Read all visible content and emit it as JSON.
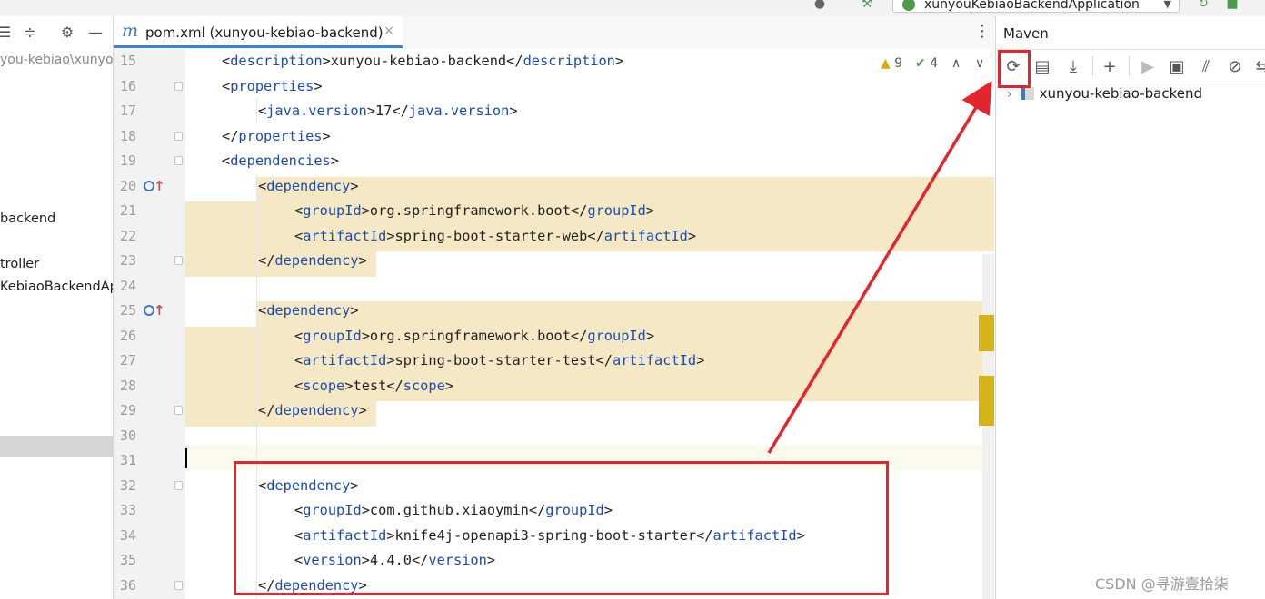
{
  "top_toolbar": {
    "run_config": "xunyouKebiaoBackendApplication"
  },
  "project_pane": {
    "path_fragment": "you-kebiao\\xunyo",
    "items": [
      "backend",
      "troller",
      "KebiaoBackendAp"
    ]
  },
  "editor": {
    "tab": {
      "icon_letter": "m",
      "title": "pom.xml (xunyou-kebiao-backend)",
      "close": "×"
    },
    "inspections": {
      "warnings": "9",
      "weak_warnings": "4"
    },
    "lines": [
      {
        "n": "15",
        "seg": [
          [
            "  "
          ],
          [
            "<",
            "p"
          ],
          [
            "description",
            "t"
          ],
          [
            ">xunyou-kebiao-backend</",
            "p"
          ],
          [
            "description",
            "t"
          ],
          [
            ">",
            "p"
          ]
        ]
      },
      {
        "n": "16",
        "seg": [
          [
            "<",
            "p"
          ],
          [
            "properties",
            "t"
          ],
          [
            ">",
            "p"
          ]
        ]
      },
      {
        "n": "17",
        "seg": [
          [
            "<",
            "p"
          ],
          [
            "java.version",
            "t"
          ],
          [
            ">17</",
            "p"
          ],
          [
            "java.version",
            "t"
          ],
          [
            ">",
            "p"
          ]
        ]
      },
      {
        "n": "18",
        "seg": [
          [
            "</",
            "p"
          ],
          [
            "properties",
            "t"
          ],
          [
            ">",
            "p"
          ]
        ]
      },
      {
        "n": "19",
        "seg": [
          [
            "<",
            "p"
          ],
          [
            "dependencies",
            "t"
          ],
          [
            ">",
            "p"
          ]
        ]
      },
      {
        "n": "20",
        "seg": [
          [
            "<",
            "p"
          ],
          [
            "dependency",
            "t"
          ],
          [
            ">",
            "p"
          ]
        ]
      },
      {
        "n": "21",
        "seg": [
          [
            "<",
            "p"
          ],
          [
            "groupId",
            "t"
          ],
          [
            ">org.springframework.boot</",
            "p"
          ],
          [
            "groupId",
            "t"
          ],
          [
            ">",
            "p"
          ]
        ]
      },
      {
        "n": "22",
        "seg": [
          [
            "<",
            "p"
          ],
          [
            "artifactId",
            "t"
          ],
          [
            ">spring-boot-starter-web</",
            "p"
          ],
          [
            "artifactId",
            "t"
          ],
          [
            ">",
            "p"
          ]
        ]
      },
      {
        "n": "23",
        "seg": [
          [
            "</",
            "p"
          ],
          [
            "dependency",
            "t"
          ],
          [
            ">",
            "p"
          ]
        ]
      },
      {
        "n": "24",
        "seg": []
      },
      {
        "n": "25",
        "seg": [
          [
            "<",
            "p"
          ],
          [
            "dependency",
            "t"
          ],
          [
            ">",
            "p"
          ]
        ]
      },
      {
        "n": "26",
        "seg": [
          [
            "<",
            "p"
          ],
          [
            "groupId",
            "t"
          ],
          [
            ">org.springframework.boot</",
            "p"
          ],
          [
            "groupId",
            "t"
          ],
          [
            ">",
            "p"
          ]
        ]
      },
      {
        "n": "27",
        "seg": [
          [
            "<",
            "p"
          ],
          [
            "artifactId",
            "t"
          ],
          [
            ">spring-boot-starter-test</",
            "p"
          ],
          [
            "artifactId",
            "t"
          ],
          [
            ">",
            "p"
          ]
        ]
      },
      {
        "n": "28",
        "seg": [
          [
            "<",
            "p"
          ],
          [
            "scope",
            "t"
          ],
          [
            ">test</",
            "p"
          ],
          [
            "scope",
            "t"
          ],
          [
            ">",
            "p"
          ]
        ]
      },
      {
        "n": "29",
        "seg": [
          [
            "</",
            "p"
          ],
          [
            "dependency",
            "t"
          ],
          [
            ">",
            "p"
          ]
        ]
      },
      {
        "n": "30",
        "seg": []
      },
      {
        "n": "31",
        "seg": []
      },
      {
        "n": "32",
        "seg": [
          [
            "<",
            "p"
          ],
          [
            "dependency",
            "t"
          ],
          [
            ">",
            "p"
          ]
        ]
      },
      {
        "n": "33",
        "seg": [
          [
            "<",
            "p"
          ],
          [
            "groupId",
            "t"
          ],
          [
            ">com.github.xiaoymin</",
            "p"
          ],
          [
            "groupId",
            "t"
          ],
          [
            ">",
            "p"
          ]
        ]
      },
      {
        "n": "34",
        "seg": [
          [
            "<",
            "p"
          ],
          [
            "artifactId",
            "t"
          ],
          [
            ">knife4j-openapi3-spring-boot-starter</",
            "p"
          ],
          [
            "artifactId",
            "t"
          ],
          [
            ">",
            "p"
          ]
        ]
      },
      {
        "n": "35",
        "seg": [
          [
            "<",
            "p"
          ],
          [
            "version",
            "t"
          ],
          [
            ">4.4.0</",
            "p"
          ],
          [
            "version",
            "t"
          ],
          [
            ">",
            "p"
          ]
        ]
      },
      {
        "n": "36",
        "seg": [
          [
            "</",
            "p"
          ],
          [
            "dependency",
            "t"
          ],
          [
            ">",
            "p"
          ]
        ]
      }
    ]
  },
  "maven": {
    "title": "Maven",
    "project": "xunyou-kebiao-backend"
  },
  "watermark": "CSDN @寻游壹拾柒",
  "colors": {
    "tag": "#1a4bb3",
    "highlight": "#f5e9c5",
    "annotation": "#e3262e",
    "accent": "#4083c9"
  }
}
